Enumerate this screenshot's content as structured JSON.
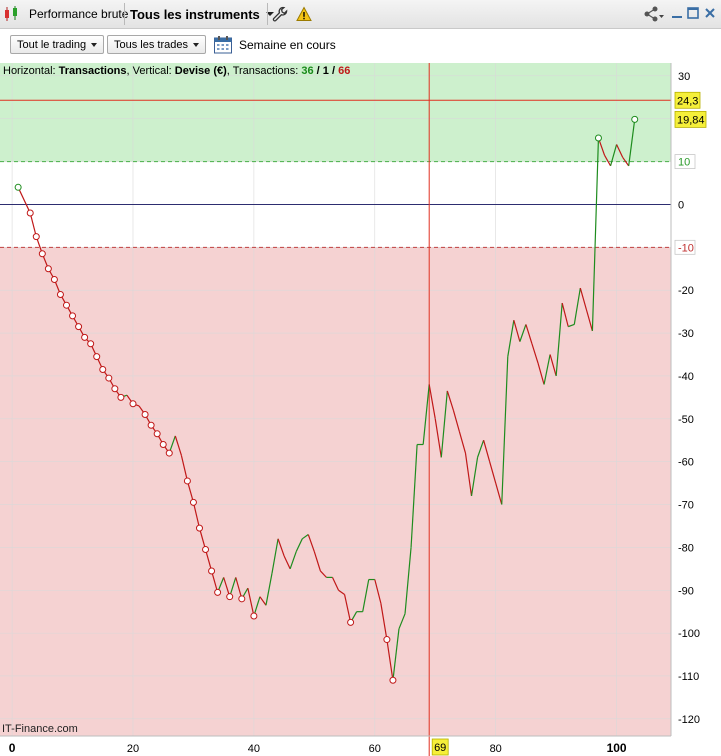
{
  "tabbar": {
    "tab1_label": "Performance brute",
    "tab2_label": "Tous les instruments"
  },
  "toolbar": {
    "dropdown1": "Tout le trading",
    "dropdown2": "Tous les trades",
    "period_label": "Semaine en cours"
  },
  "info": {
    "h_prefix": "Horizontal: ",
    "h_value": "Transactions",
    "v_prefix": ", Vertical: ",
    "v_value": "Devise (€)",
    "t_prefix": ", Transactions: ",
    "t_wins": "36",
    "t_sep1": " / ",
    "t_even": "1",
    "t_sep2": " / ",
    "t_losses": "66"
  },
  "credit": "IT-Finance.com",
  "colors": {
    "profit_zone": "#cdf0cd",
    "loss_zone": "#f5d2d2",
    "up_segment": "#1e8c1e",
    "down_segment": "#c01818",
    "marker_line": "#e03020",
    "label_bg": "#f5ef3a"
  },
  "chart_data": {
    "type": "line",
    "xlabel": "Transactions",
    "ylabel": "Devise (€)",
    "xlim": [
      -2,
      109
    ],
    "ylim": [
      -124,
      33
    ],
    "x_ticks": [
      0,
      20,
      40,
      60,
      80,
      100
    ],
    "x_tick_labels": [
      "0",
      "20",
      "40",
      "60",
      "80",
      "100"
    ],
    "y_ticks": [
      30,
      20,
      10,
      0,
      -10,
      -20,
      -30,
      -40,
      -50,
      -60,
      -70,
      -80,
      -90,
      -100,
      -110,
      -120
    ],
    "y_tick_labels": [
      "30",
      "",
      "10",
      "0",
      "-10",
      "-20",
      "-30",
      "-40",
      "-50",
      "-60",
      "-70",
      "-80",
      "-90",
      "-100",
      "-110",
      "-120"
    ],
    "profit_zone_from": 10,
    "loss_zone_from": -10,
    "dashed_levels": [
      10,
      -10
    ],
    "zero_line": 0,
    "max_line": 24.3,
    "max_label": "24,3",
    "last_value_label": "19,84",
    "cursor_x": 69,
    "cursor_label": "69",
    "grid": true,
    "x": [
      1,
      3,
      4,
      5,
      6,
      7,
      8,
      9,
      10,
      11,
      12,
      13,
      14,
      15,
      16,
      17,
      18,
      19,
      20,
      21,
      22,
      23,
      24,
      25,
      26,
      27,
      28,
      29,
      30,
      31,
      32,
      33,
      34,
      35,
      36,
      37,
      38,
      39,
      40,
      41,
      42,
      43,
      44,
      45,
      46,
      47,
      48,
      49,
      50,
      51,
      52,
      53,
      54,
      55,
      56,
      57,
      58,
      59,
      60,
      61,
      62,
      63,
      64,
      65,
      66,
      67,
      68,
      69,
      70,
      71,
      72,
      73,
      74,
      75,
      76,
      77,
      78,
      79,
      80,
      81,
      82,
      83,
      84,
      85,
      86,
      87,
      88,
      89,
      90,
      91,
      92,
      93,
      94,
      95,
      96,
      97,
      98,
      99,
      100,
      101,
      102,
      103
    ],
    "y": [
      4,
      -2,
      -7.5,
      -11.5,
      -15,
      -17.5,
      -21,
      -23.5,
      -26,
      -28.5,
      -31,
      -32.5,
      -35.5,
      -38.5,
      -40.5,
      -43,
      -45,
      -44.5,
      -46.5,
      -47,
      -49,
      -51.5,
      -53.5,
      -56,
      -58,
      -54,
      -58.5,
      -64.5,
      -69.5,
      -75.5,
      -80.5,
      -85.5,
      -90.5,
      -87,
      -91.5,
      -87,
      -92,
      -89.5,
      -96,
      -91.5,
      -93.5,
      -86,
      -78,
      -82,
      -85,
      -81,
      -78,
      -77,
      -81,
      -85.5,
      -87,
      -87,
      -90,
      -91,
      -97.5,
      -95,
      -95,
      -87.5,
      -87.5,
      -93,
      -101.5,
      -111,
      -99,
      -95.5,
      -80,
      -56,
      -56,
      -42,
      -50,
      -59,
      -43.5,
      -48,
      -53,
      -58,
      -68,
      -59,
      -55,
      -60,
      -65,
      -70,
      -35.5,
      -27,
      -32,
      -28,
      -32.5,
      -37,
      -42,
      -35,
      -40,
      -23,
      -28.5,
      -28,
      -19.5,
      -24.5,
      -29.5,
      15.5,
      11.5,
      9,
      14,
      11,
      9,
      19.84
    ],
    "marked_x": [
      1,
      3,
      4,
      5,
      6,
      7,
      8,
      9,
      10,
      11,
      12,
      13,
      14,
      15,
      16,
      17,
      18,
      20,
      22,
      23,
      24,
      25,
      26,
      29,
      30,
      31,
      32,
      33,
      34,
      36,
      38,
      40,
      56,
      62,
      63,
      97,
      103
    ]
  }
}
